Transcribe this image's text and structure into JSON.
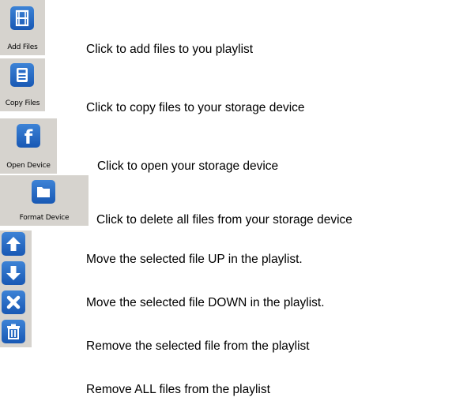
{
  "rows": [
    {
      "button": "Add Files",
      "icon": "film-icon",
      "description": "Click to add files to you playlist"
    },
    {
      "button": "Copy Files",
      "icon": "save-icon",
      "description": "Click to copy files to your storage device"
    },
    {
      "button": "Open Device",
      "icon": "facebook-f-icon",
      "description": "Click to open your storage device"
    },
    {
      "button": "Format Device",
      "icon": "folder-icon",
      "description": "Click to delete all files from your storage device"
    },
    {
      "icon": "arrow-up-icon",
      "description": "Move the selected file UP in the playlist."
    },
    {
      "icon": "arrow-down-icon",
      "description": "Move the selected file DOWN in the playlist."
    },
    {
      "icon": "close-x-icon",
      "description": "Remove the selected file from the playlist"
    },
    {
      "icon": "trash-icon",
      "description": "Remove ALL files from the playlist"
    }
  ],
  "colors": {
    "button_face": "#d6d3ce",
    "icon_blue": "#2a6cc7",
    "text": "#000000"
  }
}
